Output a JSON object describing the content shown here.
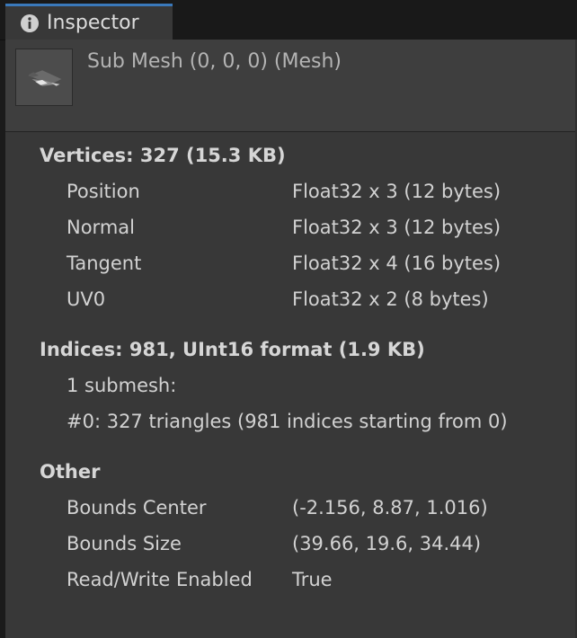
{
  "tab": {
    "label": "Inspector",
    "icon": "info-icon"
  },
  "asset": {
    "title": "Sub Mesh (0, 0, 0) (Mesh)",
    "icon": "mesh-preview-thumbnail"
  },
  "vertices": {
    "heading": "Vertices: 327 (15.3 KB)",
    "rows": [
      {
        "label": "Position",
        "value": "Float32 x 3 (12 bytes)"
      },
      {
        "label": "Normal",
        "value": "Float32 x 3 (12 bytes)"
      },
      {
        "label": "Tangent",
        "value": "Float32 x 4 (16 bytes)"
      },
      {
        "label": "UV0",
        "value": "Float32 x 2 (8 bytes)"
      }
    ]
  },
  "indices": {
    "heading": "Indices: 981, UInt16 format (1.9 KB)",
    "lines": [
      "1 submesh:",
      "#0: 327 triangles (981 indices starting from 0)"
    ]
  },
  "other": {
    "heading": "Other",
    "rows": [
      {
        "label": "Bounds Center",
        "value": "(-2.156, 8.87, 1.016)"
      },
      {
        "label": "Bounds Size",
        "value": "(39.66, 19.6, 34.44)"
      },
      {
        "label": "Read/Write Enabled",
        "value": "True"
      }
    ]
  },
  "colors": {
    "tab_accent": "#3a79bb",
    "panel_bg": "#383838",
    "header_bg": "#3e3e3e",
    "text": "#d2d2d2"
  }
}
